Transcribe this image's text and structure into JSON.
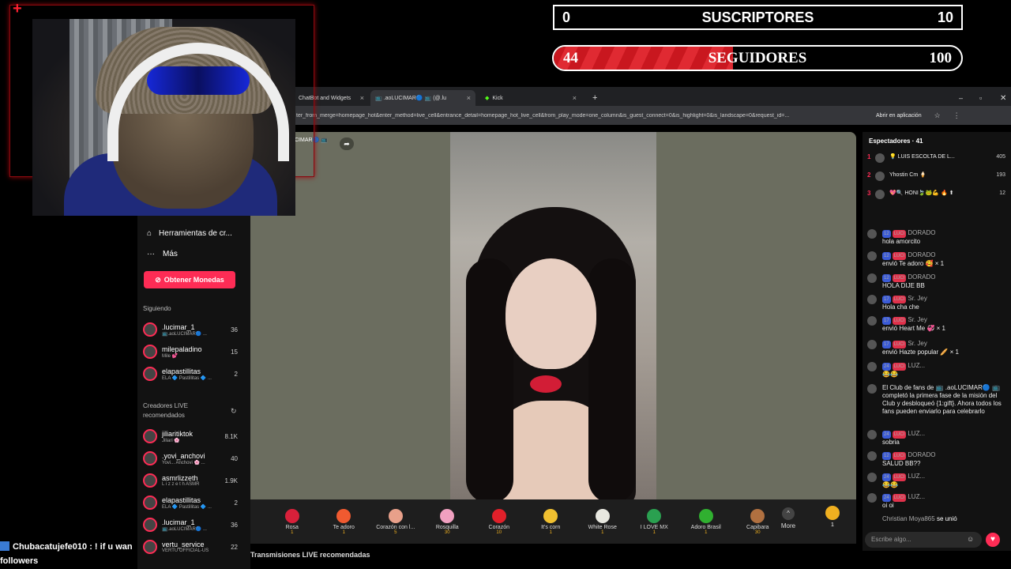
{
  "overlay": {
    "subs": {
      "current": "0",
      "label": "SUSCRIPTORES",
      "goal": "10"
    },
    "followers": {
      "current": "44",
      "label": "SEGUIDORES",
      "goal": "100",
      "progress": 0.44
    }
  },
  "browser": {
    "tabs": [
      {
        "title": "ChatBot and Widgets",
        "close": "×"
      },
      {
        "title": "📺 .aoLUCIMAR🔵 📺 (@.lu",
        "close": "×"
      },
      {
        "title": "Kick",
        "close": "×"
      }
    ],
    "new_tab": "+",
    "url": "ter_from_merge=homepage_hot&enter_method=live_cell&entrance_detail=homepage_hot_live_cell&from_play_mode=one_column&is_guest_connect=0&is_highlight=0&is_landscape=0&request_id=...",
    "open_in_app": "Abrir en aplicación"
  },
  "sidebar": {
    "creator_tools": "Herramientas de cr...",
    "more": "Más",
    "get_coins": "Obtener Monedas",
    "following_title": "Siguiendo",
    "following": [
      {
        "name": ".lucimar_1",
        "sub": "📺.aoLUCIMAR🔵 ...",
        "count": "36"
      },
      {
        "name": "milepaladino",
        "sub": "Mile 💕",
        "count": "15"
      },
      {
        "name": "elapastillitas",
        "sub": "ELA 🔷 Pastillitas 🔷 ...",
        "count": "2"
      }
    ],
    "recommended_title": "Creadores LIVE recomendados",
    "recommended": [
      {
        "name": "jiliaritiktok",
        "sub": "Jiliari 🌸",
        "count": "8.1K"
      },
      {
        "name": ".yovi_anchovi",
        "sub": "Yovi... Anchovi 🌸 ...",
        "count": "40"
      },
      {
        "name": "asmrlizzeth",
        "sub": "L i z z e t h ASMR",
        "count": "1.9K"
      },
      {
        "name": "elapastillitas",
        "sub": "ELA 🔷 Pastillitas 🔷 ...",
        "count": "2"
      },
      {
        "name": ".lucimar_1",
        "sub": "📺.aoLUCIMAR🔵 ...",
        "count": "36"
      },
      {
        "name": "vertu_service",
        "sub": "VERTU OFFICIAL-US",
        "count": "22"
      }
    ]
  },
  "stream": {
    "host_tag": "CIMAR🔵 📺",
    "bottom_label": "Transmisiones LIVE recomendadas"
  },
  "gifts": [
    {
      "name": "Rosa",
      "cost": "1",
      "color": "#d8203a"
    },
    {
      "name": "Te adoro",
      "cost": "1",
      "color": "#f05a30"
    },
    {
      "name": "Corazón con l...",
      "cost": "5",
      "color": "#e8a08a"
    },
    {
      "name": "Rosquilla",
      "cost": "30",
      "color": "#f0a0c0"
    },
    {
      "name": "Corazón",
      "cost": "10",
      "color": "#e0202a"
    },
    {
      "name": "It's corn",
      "cost": "1",
      "color": "#f0c030"
    },
    {
      "name": "White Rose",
      "cost": "1",
      "color": "#e8e8e0"
    },
    {
      "name": "I LOVE MX",
      "cost": "1",
      "color": "#2aa050"
    },
    {
      "name": "Adoro Brasil",
      "cost": "1",
      "color": "#30b030"
    },
    {
      "name": "Capibara",
      "cost": "30",
      "color": "#b07040"
    }
  ],
  "gift_more": "More",
  "coin_count": "1",
  "chat": {
    "viewers_title": "Espectadores · 41",
    "top_viewers": [
      {
        "rank": "1",
        "name": "💡 LUIS ESCOLTA DE L...",
        "score": "405"
      },
      {
        "rank": "2",
        "name": "Yhostin Cm 🍦",
        "score": "193"
      },
      {
        "rank": "3",
        "name": "💖🔍 HONI🍃🐸💪 🔥 ⬆",
        "score": "12"
      }
    ],
    "messages": [
      {
        "badge": "12",
        "user": "DORADO",
        "text": "hola amorcito"
      },
      {
        "badge": "12",
        "user": "DORADO",
        "text": "envió Te adoro 🥰 × 1"
      },
      {
        "badge": "12",
        "user": "DORADO",
        "text": "HOLA DIJE BB"
      },
      {
        "badge": "17",
        "user": "Sr. Jey",
        "text": "Hola cha che"
      },
      {
        "badge": "17",
        "user": "Sr. Jey",
        "text": "envió Heart Me 💞 × 1"
      },
      {
        "badge": "17",
        "user": "Sr. Jey",
        "text": "envió Hazte popular 🥖 × 1"
      },
      {
        "badge": "24",
        "user": "LUZ...",
        "text": "😂😂"
      },
      {
        "badge": "",
        "user": "",
        "text": "El Club de fans de 📺 .aoLUCIMAR🔵 📺 completó la primera fase de la misión del Club y desbloqueó {1:gift}. Ahora todos los fans pueden enviarlo para celebrarlo"
      },
      {
        "badge": "24",
        "user": "LUZ...",
        "text": "sobria"
      },
      {
        "badge": "12",
        "user": "DORADO",
        "text": "SALUD BB??"
      },
      {
        "badge": "24",
        "user": "LUZ...",
        "text": "😂😂"
      },
      {
        "badge": "24",
        "user": "LUZ...",
        "text": "oi oi"
      }
    ],
    "join": {
      "user": "Christian Moya865",
      "text": "se unió"
    },
    "badge_label": "LUCI",
    "input_placeholder": "Escribe algo..."
  },
  "bottom_chat": {
    "line1": "Chubacatujefe010 : ! if u wan",
    "line2": "followers"
  }
}
